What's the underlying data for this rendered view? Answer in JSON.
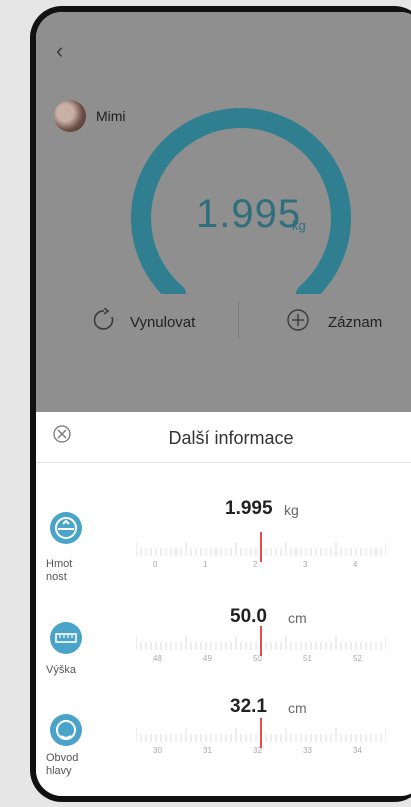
{
  "header": {
    "back_icon": "chevron-left",
    "more_icon": "more-vertical"
  },
  "user": {
    "name": "Mimi"
  },
  "reading": {
    "value": "1.995",
    "unit": "kg",
    "gauge_fraction": 0.78
  },
  "actions": {
    "reset": "Vynulovat",
    "record": "Záznam"
  },
  "sheet": {
    "title": "Další informace",
    "rows": [
      {
        "label": "Hmot\nnost",
        "value": "1.995",
        "unit": "kg",
        "ticks": [
          "0",
          "1",
          "2",
          "3",
          "4"
        ]
      },
      {
        "label": "Výška",
        "value": "50.0",
        "unit": "cm",
        "ticks": [
          "48",
          "49",
          "50",
          "51",
          "52"
        ]
      },
      {
        "label": "Obvod\nhlavy",
        "value": "32.1",
        "unit": "cm",
        "ticks": [
          "30",
          "31",
          "32",
          "33",
          "34"
        ]
      }
    ]
  },
  "colors": {
    "accent": "#4aa3c8",
    "gauge": "#2f7f91",
    "needle": "#e84b4b",
    "overlay": "#8f8f8f"
  }
}
